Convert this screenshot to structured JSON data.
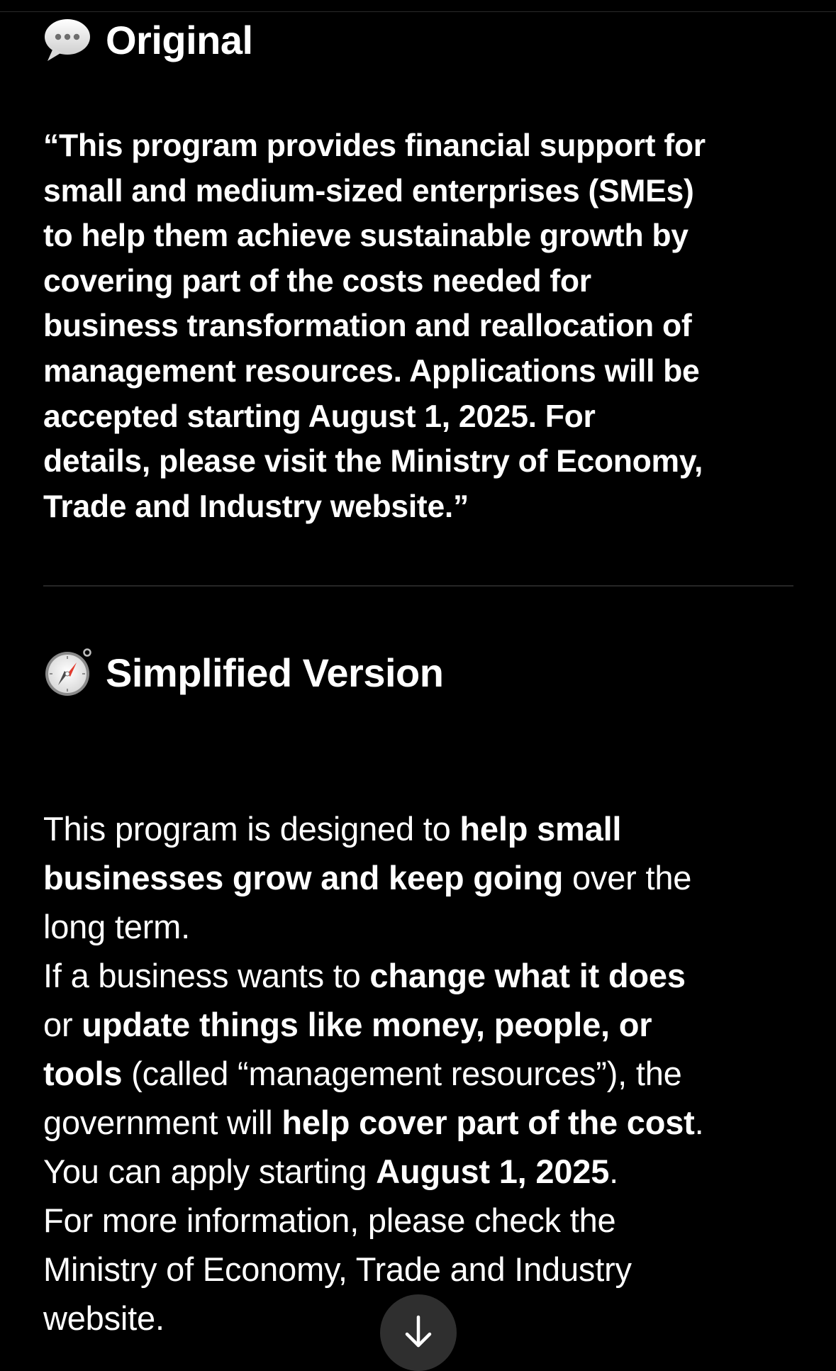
{
  "original": {
    "icon": "speech-bubble-icon",
    "title": "Original",
    "lines": [
      "“This program provides financial support for",
      "small and medium-sized enterprises (SMEs)",
      "to help them achieve sustainable growth by",
      "covering part of the costs needed for",
      "business transformation and reallocation of",
      "management resources. Applications will be",
      "accepted starting August 1, 2025. For",
      "details, please visit the Ministry of Economy,",
      "Trade and Industry website.”"
    ]
  },
  "simplified": {
    "icon": "compass-icon",
    "title": "Simplified Version",
    "p1": {
      "a": "This program is designed to ",
      "b": "help small",
      "c": "businesses grow and keep going",
      "d": " over the",
      "e": "long term."
    },
    "p2": {
      "a": "If a business wants to ",
      "b": "change what it does",
      "c": "or ",
      "d": "update things like money, people, or",
      "e": "tools",
      "f": " (called “management resources”), the",
      "g": "government will ",
      "h": "help cover part of the cost",
      "i": "."
    },
    "p3": {
      "a": "You can apply starting ",
      "b": "August 1, 2025",
      "c": "."
    },
    "p4": {
      "a": "For more information, please check the",
      "b": "Ministry of Economy, Trade and Industry",
      "c": "website."
    }
  },
  "scroll_button": {
    "icon": "arrow-down-icon"
  },
  "colors": {
    "background": "#000000",
    "text": "#ffffff",
    "divider": "#262626",
    "scroll_button_bg": "#2f2f2f"
  }
}
